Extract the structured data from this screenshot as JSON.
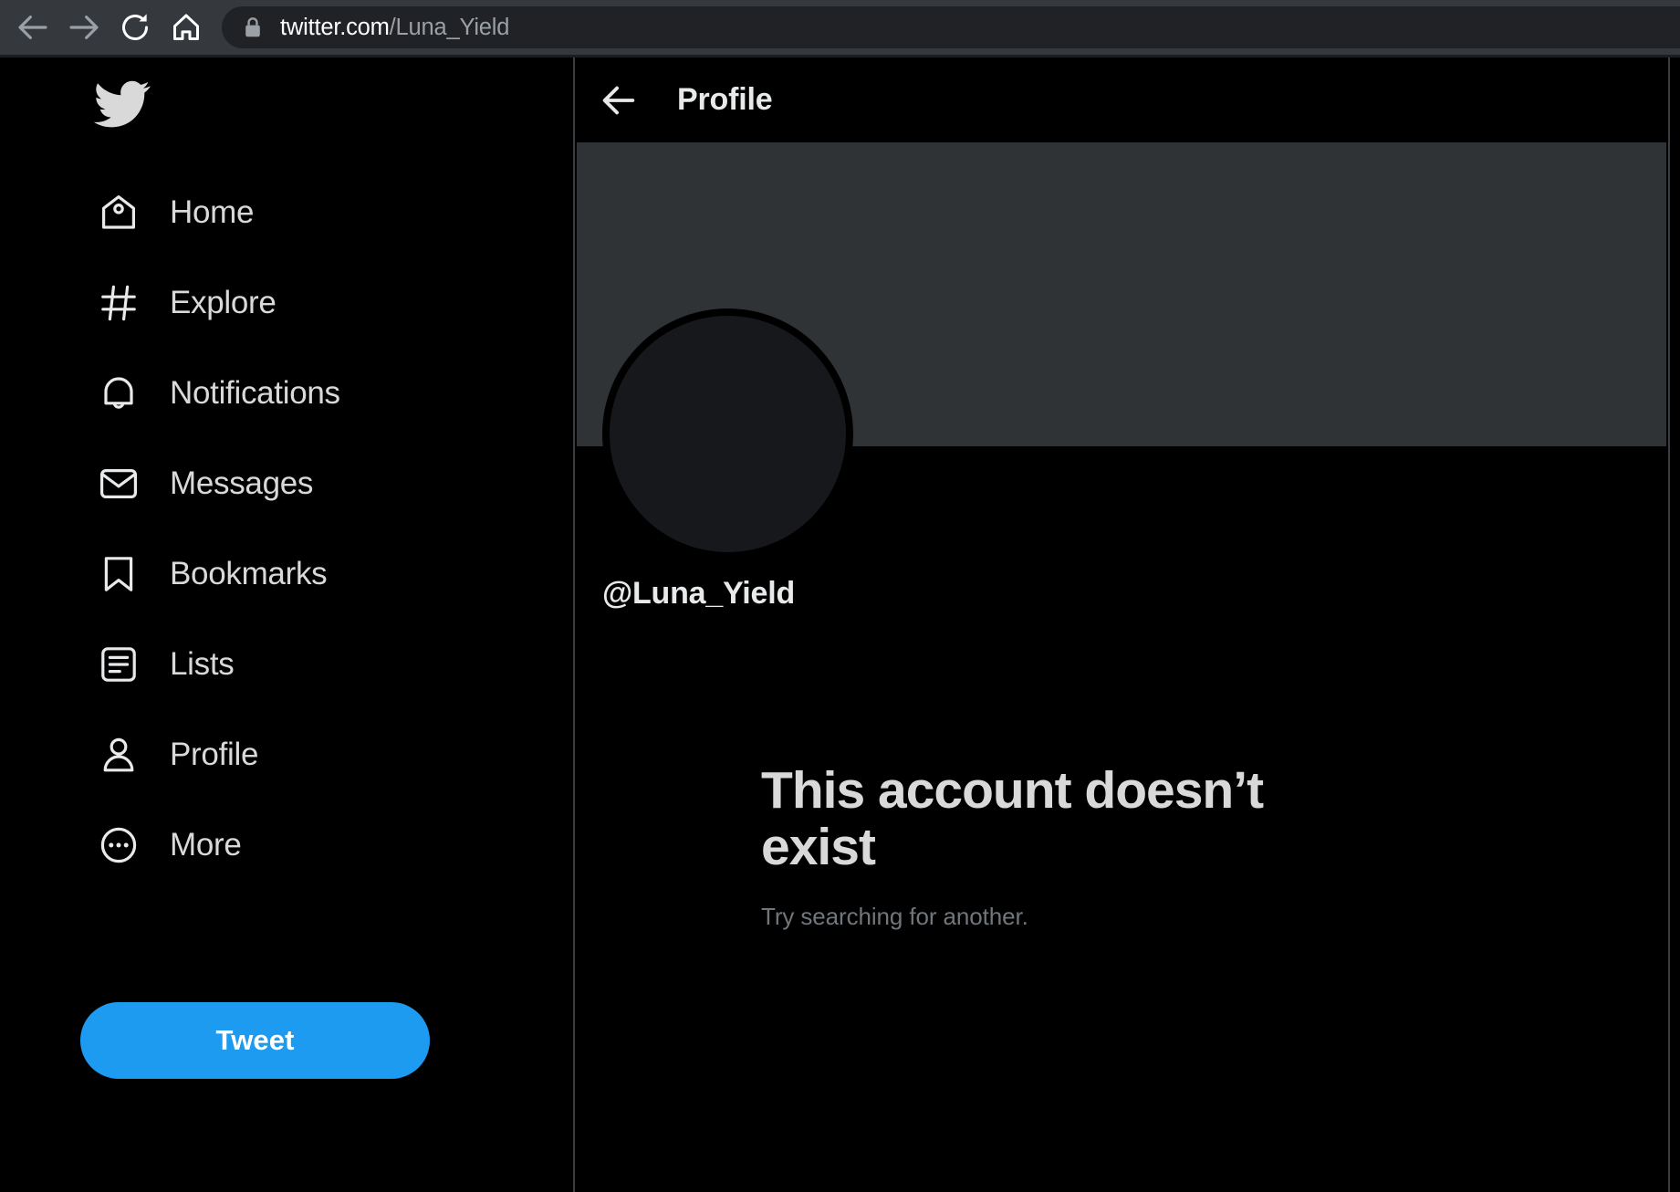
{
  "browser": {
    "back_label": "Back",
    "forward_label": "Forward",
    "reload_label": "Reload",
    "home_label": "Home",
    "lock_label": "Connection is secure",
    "url_domain": "twitter.com",
    "url_path": "/Luna_Yield",
    "colors": {
      "toolbar_bg": "#35383D",
      "url_pill_bg": "#202226",
      "url_domain_color": "#FFFFFF",
      "url_path_color": "#9AA0A6"
    }
  },
  "sidebar": {
    "logo_label": "Twitter",
    "items": [
      {
        "label": "Home",
        "icon": "home-icon"
      },
      {
        "label": "Explore",
        "icon": "hashtag-icon"
      },
      {
        "label": "Notifications",
        "icon": "bell-icon"
      },
      {
        "label": "Messages",
        "icon": "envelope-icon"
      },
      {
        "label": "Bookmarks",
        "icon": "bookmark-icon"
      },
      {
        "label": "Lists",
        "icon": "list-icon"
      },
      {
        "label": "Profile",
        "icon": "person-icon"
      },
      {
        "label": "More",
        "icon": "more-circle-icon"
      }
    ],
    "tweet_button": {
      "label": "Tweet",
      "color": "#1D9BF0",
      "text_color": "#FFFFFF"
    }
  },
  "main": {
    "header": {
      "back_label": "Back",
      "title": "Profile"
    },
    "banner_color": "#2F3336",
    "avatar_color": "#16181C",
    "handle": "@Luna_Yield",
    "empty_state": {
      "title": "This account doesn’t exist",
      "subtitle": "Try searching for another."
    }
  }
}
